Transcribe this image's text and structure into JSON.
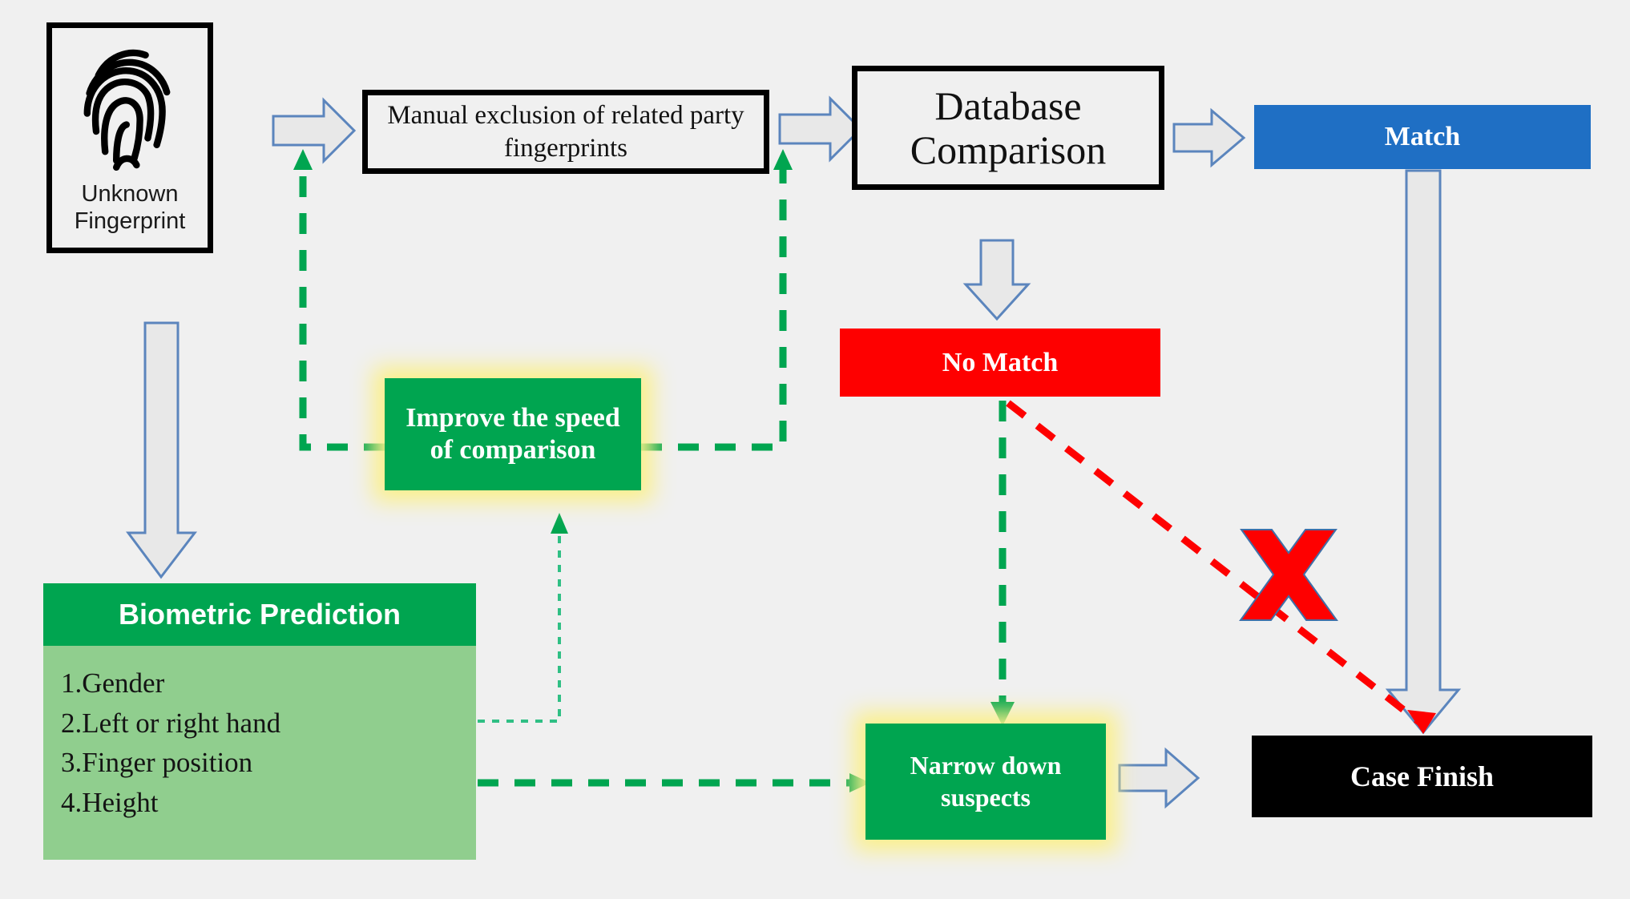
{
  "diagram": {
    "title": "Fingerprint identification workflow with biometric prediction",
    "background_color": "#f0f0f0",
    "nodes": {
      "unknown_fingerprint": {
        "label_line_1": "Unknown",
        "label_line_2": "Fingerprint",
        "icon": "fingerprint-icon",
        "border_color": "#000000",
        "fill_color": "#f0f0f0"
      },
      "manual_exclusion": {
        "label": "Manual exclusion of related party fingerprints",
        "border_color": "#000000",
        "fill_color": "#f0f0f0"
      },
      "database_comparison": {
        "label_line_1": "Database",
        "label_line_2": "Comparison",
        "border_color": "#000000",
        "fill_color": "#f0f0f0"
      },
      "match": {
        "label": "Match",
        "fill_color": "#1f6fc4",
        "text_color": "#ffffff"
      },
      "no_match": {
        "label": "No Match",
        "fill_color": "#fe0000",
        "text_color": "#ffffff"
      },
      "improve_speed": {
        "label_line_1": "Improve the speed",
        "label_line_2": "of comparison",
        "fill_color": "#00a550",
        "glow_color": "#fbf08a",
        "text_color": "#ffffff"
      },
      "narrow_down": {
        "label_line_1": "Narrow down",
        "label_line_2": "suspects",
        "fill_color": "#00a550",
        "glow_color": "#fbf08a",
        "text_color": "#ffffff"
      },
      "biometric_prediction": {
        "header": "Biometric Prediction",
        "header_fill": "#00a550",
        "body_fill": "#90ce8e",
        "items": [
          "1.Gender",
          "2.Left or right hand",
          "3.Finger position",
          "4.Height"
        ]
      },
      "case_finish": {
        "label": "Case Finish",
        "fill_color": "#000000",
        "text_color": "#ffffff"
      }
    },
    "connectors": {
      "gray_block_arrows": {
        "fill_color": "#e8e8e8",
        "stroke_color": "#5b85bd",
        "items": [
          "unknown-to-manual-exclusion",
          "manual-exclusion-to-database",
          "database-to-match",
          "database-to-no-match",
          "unknown-to-biometric",
          "narrow-down-to-case-finish",
          "match-to-case-finish"
        ]
      },
      "green_dashed_arrows": {
        "color": "#00a550",
        "items": [
          "improve-speed-to-manual-exclusion",
          "improve-speed-to-database",
          "biometric-to-improve-speed",
          "biometric-to-narrow-down",
          "no-match-to-narrow-down"
        ]
      },
      "red_dashed_arrow": {
        "color": "#fe0000",
        "item": "no-match-to-case-finish-blocked"
      },
      "cross_mark": {
        "symbol": "x-cross-icon",
        "color": "#fe0000"
      }
    }
  }
}
